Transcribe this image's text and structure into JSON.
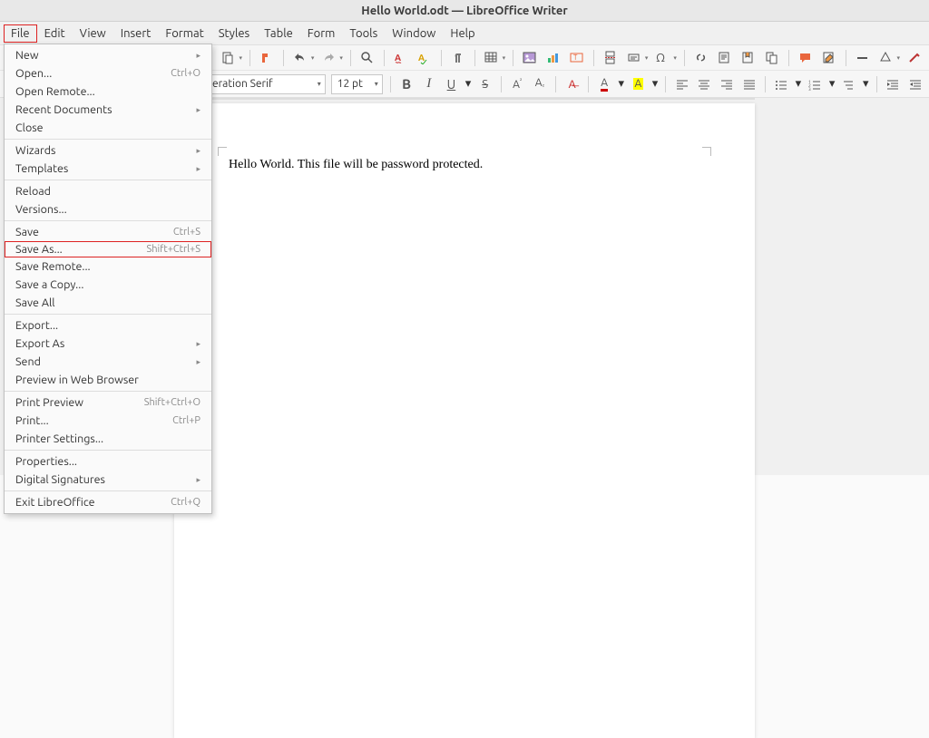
{
  "title": "Hello World.odt — LibreOffice Writer",
  "menubar": [
    "File",
    "Edit",
    "View",
    "Insert",
    "Format",
    "Styles",
    "Table",
    "Form",
    "Tools",
    "Window",
    "Help"
  ],
  "active_menu_index": 0,
  "file_menu": [
    {
      "label": "New",
      "sub": true
    },
    {
      "label": "Open...",
      "accel": "Ctrl+O"
    },
    {
      "label": "Open Remote..."
    },
    {
      "label": "Recent Documents",
      "sub": true
    },
    {
      "label": "Close"
    },
    {
      "div": true
    },
    {
      "label": "Wizards",
      "sub": true
    },
    {
      "label": "Templates",
      "sub": true
    },
    {
      "div": true
    },
    {
      "label": "Reload"
    },
    {
      "label": "Versions..."
    },
    {
      "div": true
    },
    {
      "label": "Save",
      "accel": "Ctrl+S"
    },
    {
      "label": "Save As...",
      "accel": "Shift+Ctrl+S",
      "highlight": true
    },
    {
      "label": "Save Remote..."
    },
    {
      "label": "Save a Copy..."
    },
    {
      "label": "Save All"
    },
    {
      "div": true
    },
    {
      "label": "Export..."
    },
    {
      "label": "Export As",
      "sub": true
    },
    {
      "label": "Send",
      "sub": true
    },
    {
      "label": "Preview in Web Browser"
    },
    {
      "div": true
    },
    {
      "label": "Print Preview",
      "accel": "Shift+Ctrl+O"
    },
    {
      "label": "Print...",
      "accel": "Ctrl+P"
    },
    {
      "label": "Printer Settings..."
    },
    {
      "div": true
    },
    {
      "label": "Properties..."
    },
    {
      "label": "Digital Signatures",
      "sub": true
    },
    {
      "div": true
    },
    {
      "label": "Exit LibreOffice",
      "accel": "Ctrl+Q"
    }
  ],
  "font_name": "eration Serif",
  "font_size": "12 pt",
  "document_text": "Hello World. This file will be password protected.",
  "colors": {
    "highlight_border": "#d22",
    "accent_orange": "#e9663c"
  }
}
